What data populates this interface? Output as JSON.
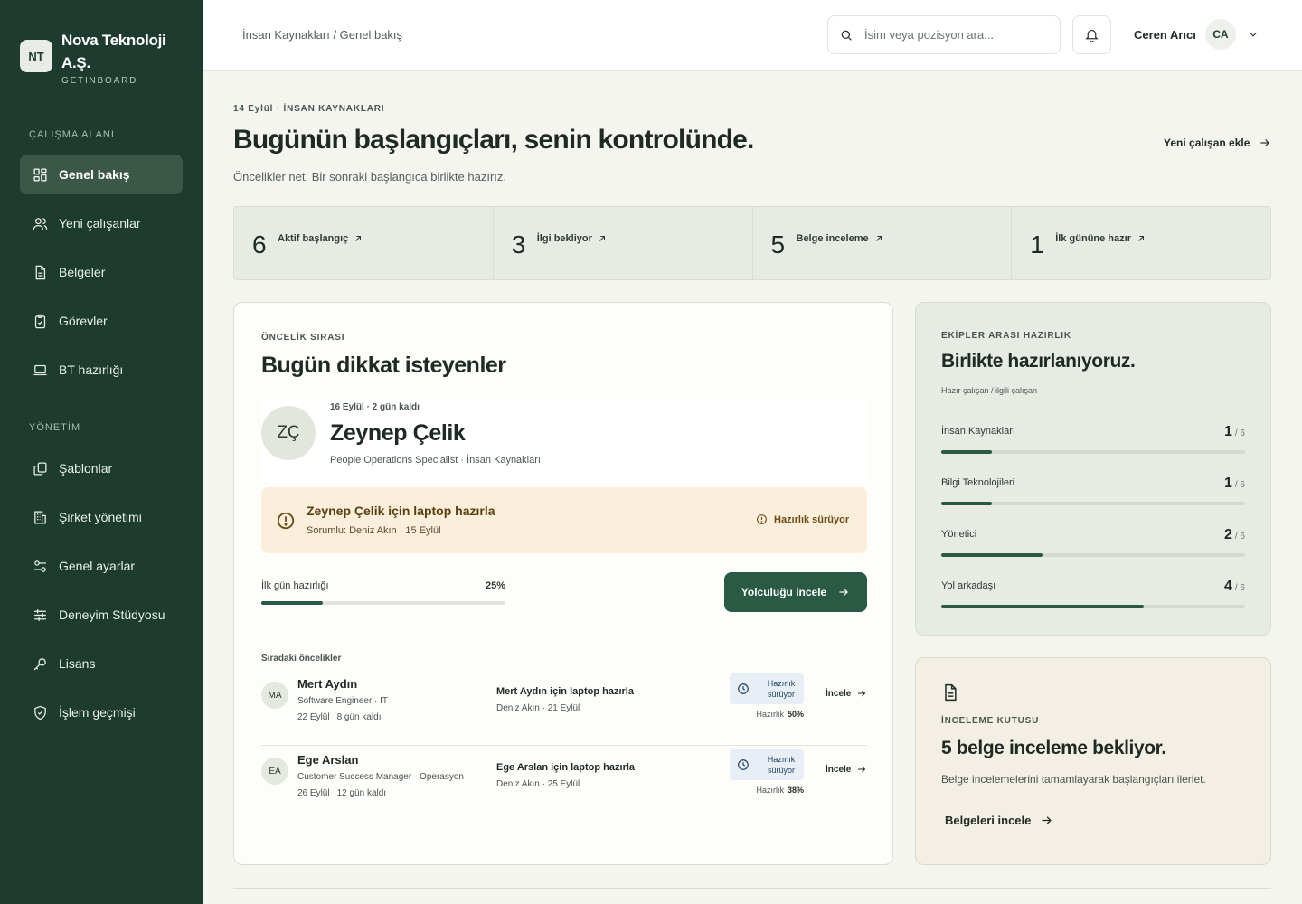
{
  "brand": {
    "logo": "NT",
    "name": "Nova Teknoloji A.Ş.",
    "sub": "GETINBOARD"
  },
  "sidebar": {
    "section_workspace": "ÇALIŞMA ALANI",
    "section_management": "YÖNETİM",
    "items": [
      {
        "label": "Genel bakış",
        "icon": "dashboard-icon"
      },
      {
        "label": "Yeni çalışanlar",
        "icon": "users-icon"
      },
      {
        "label": "Belgeler",
        "icon": "document-icon"
      },
      {
        "label": "Görevler",
        "icon": "clipboard-check-icon"
      },
      {
        "label": "BT hazırlığı",
        "icon": "laptop-icon"
      },
      {
        "label": "Şablonlar",
        "icon": "copy-icon"
      },
      {
        "label": "Şirket yönetimi",
        "icon": "building-icon"
      },
      {
        "label": "Genel ayarlar",
        "icon": "settings-sliders-icon"
      },
      {
        "label": "Deneyim Stüdyosu",
        "icon": "adjustments-icon"
      },
      {
        "label": "Lisans",
        "icon": "key-icon"
      },
      {
        "label": "İşlem geçmişi",
        "icon": "shield-check-icon"
      }
    ]
  },
  "topbar": {
    "breadcrumb": "İnsan Kaynakları / Genel bakış",
    "search_placeholder": "İsim veya pozisyon ara...",
    "user_name": "Ceren Arıcı",
    "user_initials": "CA"
  },
  "header": {
    "eyebrow": "14 Eylül · İNSAN KAYNAKLARI",
    "title": "Bugünün başlangıçları, senin kontrolünde.",
    "subtitle": "Öncelikler net. Bir sonraki başlangıca birlikte hazırız.",
    "add_employee": "Yeni çalışan ekle"
  },
  "stats": [
    {
      "value": "6",
      "label": "Aktif başlangıç"
    },
    {
      "value": "3",
      "label": "İlgi bekliyor"
    },
    {
      "value": "5",
      "label": "Belge inceleme"
    },
    {
      "value": "1",
      "label": "İlk gününe hazır"
    }
  ],
  "priority": {
    "eyebrow": "ÖNCELİK SIRASI",
    "title": "Bugün dikkat isteyenler",
    "hero": {
      "initials": "ZÇ",
      "meta": "16 Eylül · 2 gün kaldı",
      "name": "Zeynep Çelik",
      "role": "People Operations Specialist · İnsan Kaynakları"
    },
    "alert": {
      "title": "Zeynep Çelik için laptop hazırla",
      "sub": "Sorumlu: Deniz Akın · 15 Eylül",
      "status": "Hazırlık sürüyor"
    },
    "progress_label": "İlk gün hazırlığı",
    "progress_value": "25%",
    "progress_fraction": 0.25,
    "journey_button": "Yolculuğu incele",
    "next_label": "Sıradaki öncelikler",
    "rows": [
      {
        "initials": "MA",
        "name": "Mert Aydın",
        "role": "Software Engineer · IT",
        "date": "22 Eylül",
        "remaining": "8 gün kaldı",
        "task": "Mert Aydın için laptop hazırla",
        "task_sub": "Deniz Akın · 21 Eylül",
        "status": "Hazırlık sürüyor",
        "progress_label": "Hazırlık",
        "progress_value": "50%",
        "link": "İncele"
      },
      {
        "initials": "EA",
        "name": "Ege Arslan",
        "role": "Customer Success Manager · Operasyon",
        "date": "26 Eylül",
        "remaining": "12 gün kaldı",
        "task": "Ege Arslan için laptop hazırla",
        "task_sub": "Deniz Akın · 25 Eylül",
        "status": "Hazırlık sürüyor",
        "progress_label": "Hazırlık",
        "progress_value": "38%",
        "link": "İncele"
      }
    ]
  },
  "readiness": {
    "eyebrow": "EKİPLER ARASI HAZIRLIK",
    "title": "Birlikte hazırlanıyoruz.",
    "sub": "Hazır çalışan / ilgili çalışan",
    "teams": [
      {
        "name": "İnsan Kaynakları",
        "ready": "1",
        "total": "/ 6",
        "fraction": 0.1667
      },
      {
        "name": "Bilgi Teknolojileri",
        "ready": "1",
        "total": "/ 6",
        "fraction": 0.1667
      },
      {
        "name": "Yönetici",
        "ready": "2",
        "total": "/ 6",
        "fraction": 0.3333
      },
      {
        "name": "Yol arkadaşı",
        "ready": "4",
        "total": "/ 6",
        "fraction": 0.6667
      }
    ]
  },
  "inbox": {
    "eyebrow": "İNCELEME KUTUSU",
    "title": "5 belge inceleme bekliyor.",
    "sub": "Belge incelemelerini tamamlayarak başlangıçları ilerlet.",
    "link": "Belgeleri incele"
  },
  "colors": {
    "sidebar": "#1d3b2e",
    "accent": "#2a5a44",
    "alert_bg": "#fbeedb",
    "status_bg": "#e7eef6"
  }
}
